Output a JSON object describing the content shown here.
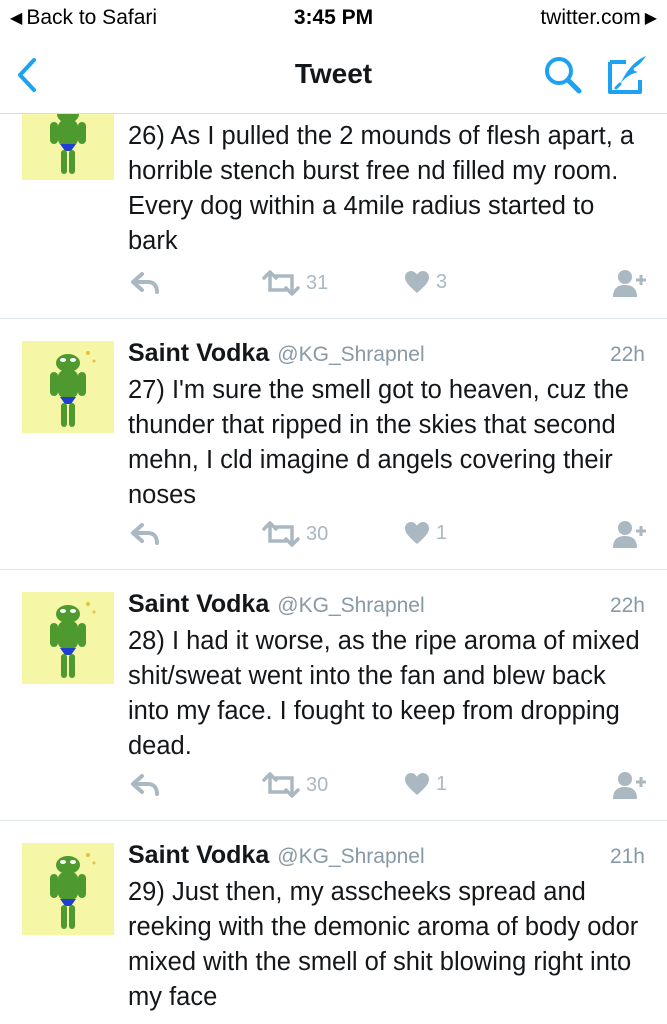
{
  "status_bar": {
    "back_label": "Back to Safari",
    "time": "3:45 PM",
    "site": "twitter.com"
  },
  "nav": {
    "title": "Tweet"
  },
  "colors": {
    "accent": "#1da1f2",
    "muted": "#8899a6",
    "action_gray": "#aab8c2",
    "avatar_bg": "#f6f7a6"
  },
  "tweets": [
    {
      "name": "",
      "handle": "",
      "time": "",
      "text": "26) As I pulled the 2 mounds of flesh apart, a horrible stench burst free nd filled my room. Every dog within a 4mile radius started to bark",
      "retweets": "31",
      "likes": "3"
    },
    {
      "name": "Saint Vodka",
      "handle": "@KG_Shrapnel",
      "time": "22h",
      "text": "27) I'm sure the smell got to heaven, cuz the thunder that ripped in the skies that second mehn, I cld imagine d angels covering their noses",
      "retweets": "30",
      "likes": "1"
    },
    {
      "name": "Saint Vodka",
      "handle": "@KG_Shrapnel",
      "time": "22h",
      "text": "28) I had it worse, as the ripe aroma of mixed shit/sweat went into the fan and blew back into my face. I fought to keep from dropping dead.",
      "retweets": "30",
      "likes": "1"
    },
    {
      "name": "Saint Vodka",
      "handle": "@KG_Shrapnel",
      "time": "21h",
      "text": "29) Just then, my asscheeks spread and reeking with the demonic aroma of body odor mixed with the smell of shit blowing right into my face"
    }
  ],
  "icons": {
    "back": "chevron-left-icon",
    "search": "search-icon",
    "compose": "compose-icon",
    "reply": "reply-icon",
    "retweet": "retweet-icon",
    "like": "heart-icon",
    "follow": "add-user-icon"
  }
}
